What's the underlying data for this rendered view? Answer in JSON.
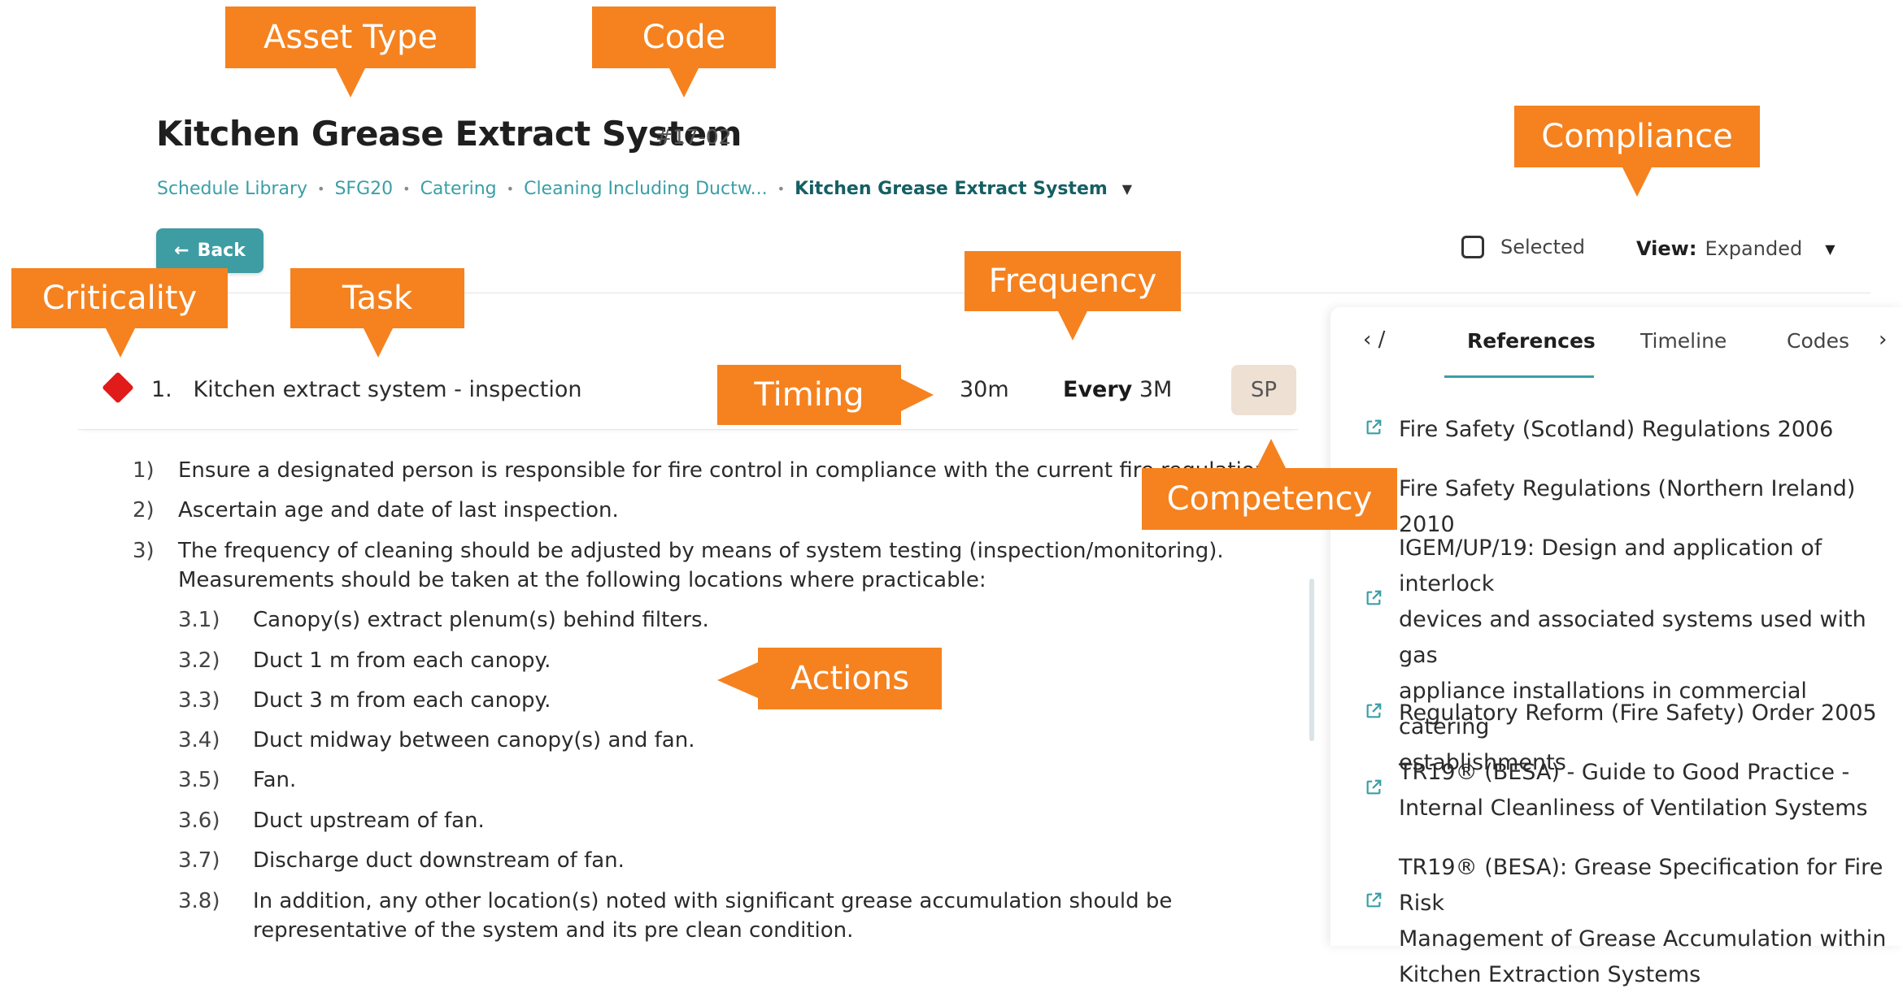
{
  "header": {
    "title": "Kitchen Grease Extract System",
    "code": "#17-02",
    "breadcrumb": [
      "Schedule Library",
      "SFG20",
      "Catering",
      "Cleaning Including Ductw...",
      "Kitchen Grease Extract System"
    ],
    "back_label": "Back"
  },
  "controls": {
    "selected_label": "Selected",
    "view_label": "View:",
    "view_value": "Expanded"
  },
  "task": {
    "number": "1.",
    "name": "Kitchen extract system - inspection",
    "timing": "30m",
    "frequency_prefix": "Every",
    "frequency_value": "3M",
    "competency": "SP",
    "criticality_color": "#e11a1a"
  },
  "actions": [
    {
      "num": "1)",
      "text": "Ensure a designated person is responsible for fire control in compliance with the current fire regulations."
    },
    {
      "num": "2)",
      "text": "Ascertain age and date of last inspection."
    },
    {
      "num": "3)",
      "text": "The frequency of cleaning should be adjusted by means of system testing (inspection/monitoring).",
      "text2": "Measurements should be taken at the following locations where practicable:"
    },
    {
      "num": "3.1)",
      "text": "Canopy(s) extract plenum(s) behind filters."
    },
    {
      "num": "3.2)",
      "text": "Duct 1 m from each canopy."
    },
    {
      "num": "3.3)",
      "text": "Duct 3 m from each canopy."
    },
    {
      "num": "3.4)",
      "text": "Duct midway between canopy(s) and fan."
    },
    {
      "num": "3.5)",
      "text": "Fan."
    },
    {
      "num": "3.6)",
      "text": "Duct upstream of fan."
    },
    {
      "num": "3.7)",
      "text": "Discharge duct downstream of fan."
    },
    {
      "num": "3.8)",
      "text": "In addition, any other location(s) noted with significant grease accumulation should be",
      "text2": "representative of the system and its pre clean condition."
    }
  ],
  "panel": {
    "tabs": [
      "References",
      "Timeline",
      "Codes"
    ],
    "active_tab": "References",
    "references": [
      [
        "Fire Safety (Scotland) Regulations 2006"
      ],
      [
        "Fire Safety Regulations (Northern Ireland) 2010"
      ],
      [
        "IGEM/UP/19: Design and application of interlock",
        "devices and associated systems used with gas",
        "appliance installations in commercial catering",
        "establishments"
      ],
      [
        "Regulatory Reform (Fire Safety) Order 2005"
      ],
      [
        "TR19® (BESA) - Guide to Good Practice -",
        "Internal Cleanliness of Ventilation Systems"
      ],
      [
        "TR19® (BESA): Grease Specification for Fire Risk",
        "Management of Grease Accumulation within",
        "Kitchen Extraction Systems"
      ]
    ]
  },
  "annotations": {
    "asset_type": "Asset Type",
    "code": "Code",
    "compliance": "Compliance",
    "criticality": "Criticality",
    "task": "Task",
    "frequency": "Frequency",
    "timing": "Timing",
    "competency": "Competency",
    "actions": "Actions",
    "callout_color": "#f5821f"
  }
}
